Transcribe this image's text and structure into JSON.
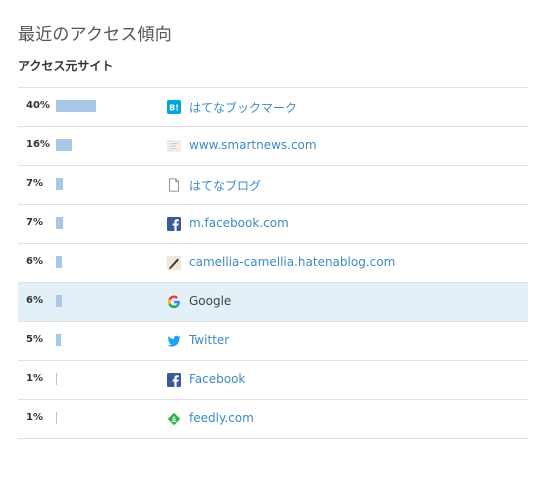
{
  "header": {
    "title": "最近のアクセス傾向",
    "section_title": "アクセス元サイト"
  },
  "colors": {
    "bar": "#a8c8e6",
    "link": "#3d8bc4",
    "highlight_row": "#e3f0f7",
    "divider": "#e2e2e2"
  },
  "referrers": [
    {
      "percent_label": "40%",
      "share": 40,
      "site": "はてなブックマーク",
      "icon": "hatena-bookmark-icon",
      "highlighted": false
    },
    {
      "percent_label": "16%",
      "share": 16,
      "site": "www.smartnews.com",
      "icon": "smartnews-icon",
      "highlighted": false
    },
    {
      "percent_label": "7%",
      "share": 7,
      "site": "はてなブログ",
      "icon": "document-icon",
      "highlighted": false
    },
    {
      "percent_label": "7%",
      "share": 7,
      "site": "m.facebook.com",
      "icon": "facebook-icon",
      "highlighted": false
    },
    {
      "percent_label": "6%",
      "share": 6,
      "site": "camellia-camellia.hatenablog.com",
      "icon": "blog-favicon-icon",
      "highlighted": false
    },
    {
      "percent_label": "6%",
      "share": 6,
      "site": "Google",
      "icon": "google-icon",
      "highlighted": true
    },
    {
      "percent_label": "5%",
      "share": 5,
      "site": "Twitter",
      "icon": "twitter-icon",
      "highlighted": false
    },
    {
      "percent_label": "1%",
      "share": 1,
      "site": "Facebook",
      "icon": "facebook-icon",
      "highlighted": false
    },
    {
      "percent_label": "1%",
      "share": 1,
      "site": "feedly.com",
      "icon": "feedly-icon",
      "highlighted": false
    }
  ]
}
